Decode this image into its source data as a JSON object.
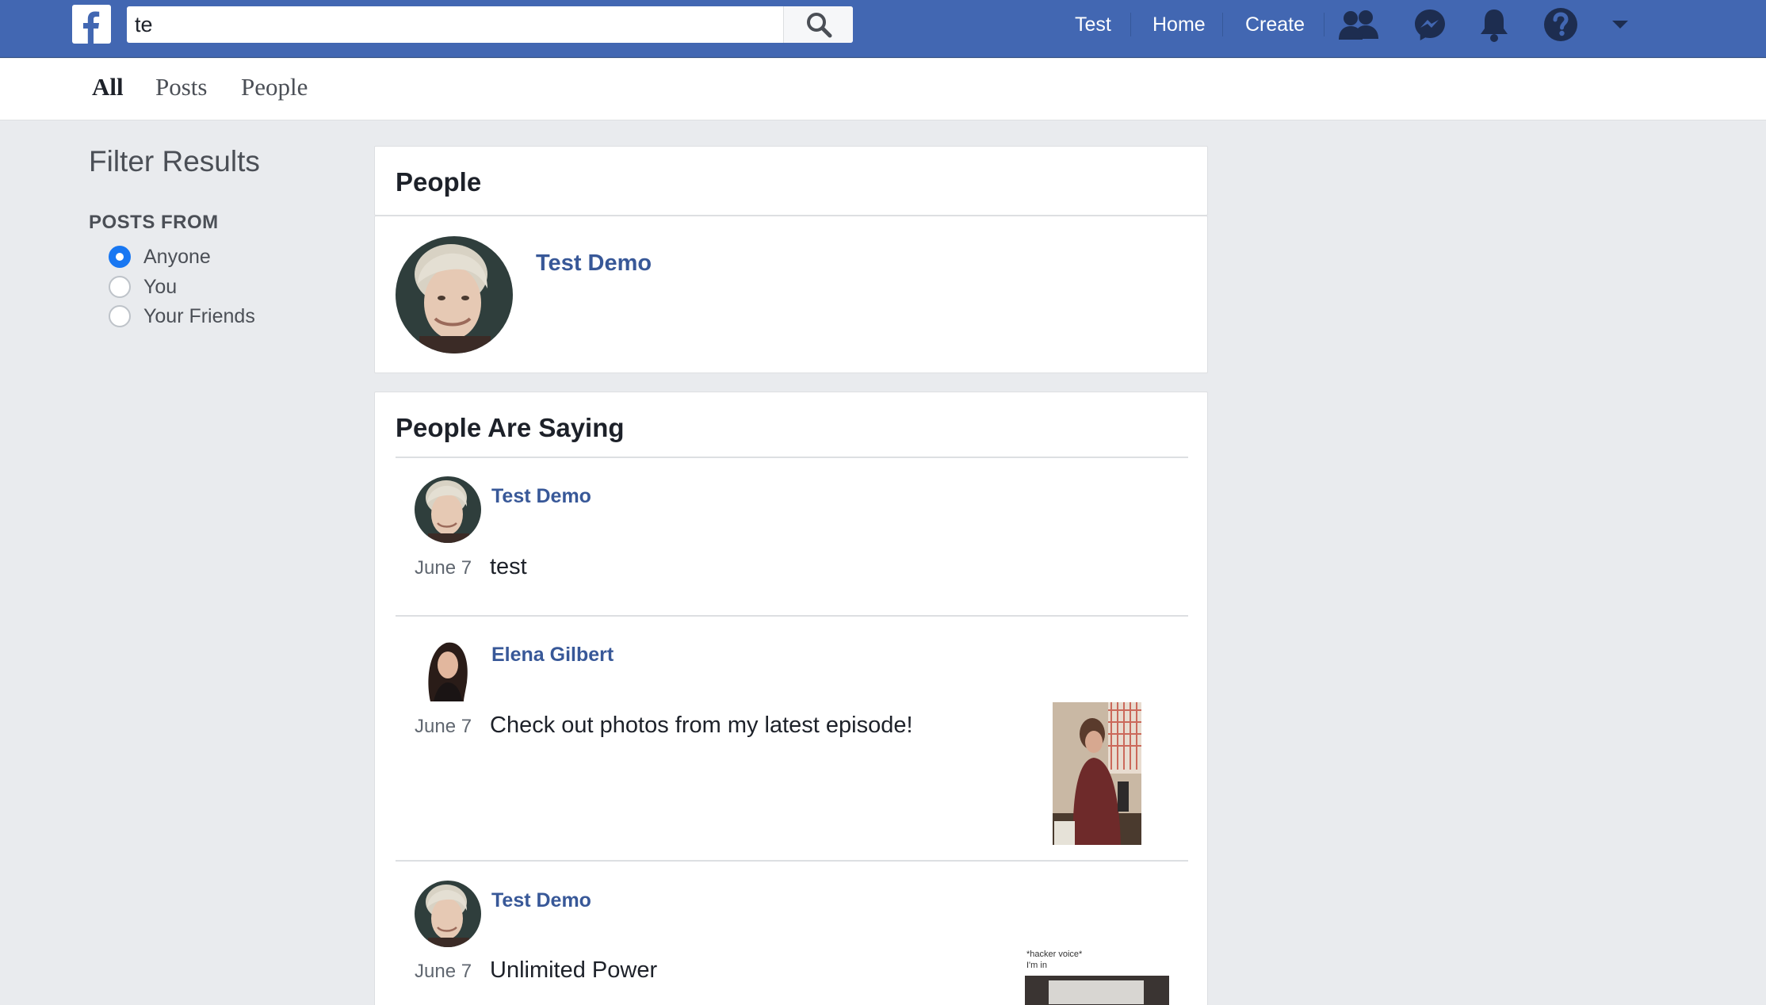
{
  "header": {
    "search_value": "te",
    "nav": [
      "Test",
      "Home",
      "Create"
    ],
    "icons": [
      "friends-icon",
      "messenger-icon",
      "notifications-icon",
      "help-icon",
      "dropdown-icon"
    ]
  },
  "tabs": [
    "All",
    "Posts",
    "People"
  ],
  "sidebar": {
    "title": "Filter Results",
    "section": "POSTS FROM",
    "options": [
      {
        "label": "Anyone",
        "checked": true
      },
      {
        "label": "You",
        "checked": false
      },
      {
        "label": "Your Friends",
        "checked": false
      }
    ]
  },
  "people": {
    "title": "People",
    "results": [
      {
        "name": "Test Demo"
      }
    ]
  },
  "saying": {
    "title": "People Are Saying",
    "posts": [
      {
        "author": "Test Demo",
        "date": "June 7",
        "text": "test"
      },
      {
        "author": "Elena Gilbert",
        "date": "June 7",
        "text": "Check out photos from my latest episode!"
      },
      {
        "author": "Test Demo",
        "date": "June 7",
        "text": "Unlimited Power",
        "thumb_caption_1": "*hacker voice*",
        "thumb_caption_2": "I'm in"
      }
    ]
  },
  "colors": {
    "brand_blue": "#4267b2",
    "link_blue": "#385898",
    "radio_checked": "#1877f2",
    "page_bg": "#e9ebee"
  }
}
